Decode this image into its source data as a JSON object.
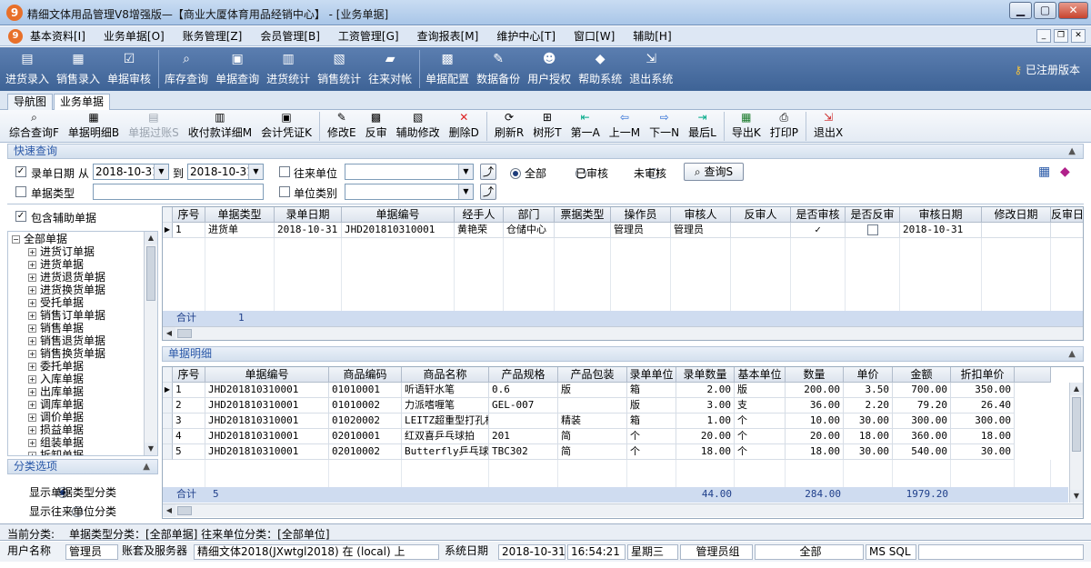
{
  "window": {
    "title": "精细文体用品管理V8增强版—【商业大厦体育用品经销中心】 - [业务单据]"
  },
  "menu": [
    "基本资料[I]",
    "业务单据[O]",
    "账务管理[Z]",
    "会员管理[B]",
    "工资管理[G]",
    "查询报表[M]",
    "维护中心[T]",
    "窗口[W]",
    "辅助[H]"
  ],
  "main_toolbar": [
    "进货录入",
    "销售录入",
    "单据审核",
    "库存查询",
    "单据查询",
    "进货统计",
    "销售统计",
    "往来对帐",
    "单据配置",
    "数据备份",
    "用户授权",
    "帮助系统",
    "退出系统"
  ],
  "registered": "已注册版本",
  "tabs": [
    "导航图",
    "业务单据"
  ],
  "sub_toolbar": [
    "综合查询F",
    "单据明细B",
    "单据过账S",
    "收付款详细M",
    "会计凭证K",
    "修改E",
    "反审",
    "辅助修改",
    "删除D",
    "刷新R",
    "树形T",
    "第一A",
    "上一M",
    "下一N",
    "最后L",
    "导出K",
    "打印P",
    "退出X"
  ],
  "quick": {
    "title": "快速查询",
    "date_label": "录单日期",
    "from": "从",
    "date_from": "2018-10-31",
    "to": "到",
    "date_to": "2018-10-31",
    "partner_label": "往来单位",
    "doc_type_label": "单据类型",
    "unit_cat_label": "单位类别",
    "all": "全部",
    "audited": "已审核",
    "unaudited": "未审核",
    "query_btn": "查询S",
    "include_aux": "包含辅助单据"
  },
  "tree": {
    "root": "全部单据",
    "items": [
      "进货订单据",
      "进货单据",
      "进货退货单据",
      "进货换货单据",
      "受托单据",
      "销售订单单据",
      "销售单据",
      "销售退货单据",
      "销售换货单据",
      "委托单据",
      "入库单据",
      "出库单据",
      "调库单据",
      "调价单据",
      "损益单据",
      "组装单据",
      "拆卸单据"
    ]
  },
  "class_opts": {
    "title": "分类选项",
    "opt1": "显示单据类型分类",
    "opt2": "显示往来单位分类"
  },
  "top_grid": {
    "headers": [
      "序号",
      "单据类型",
      "录单日期",
      "单据编号",
      "经手人",
      "部门",
      "票据类型",
      "操作员",
      "审核人",
      "反审人",
      "是否审核",
      "是否反审",
      "审核日期",
      "修改日期",
      "反审日期"
    ],
    "row": [
      "1",
      "进货单",
      "2018-10-31",
      "JHD201810310001",
      "黄艳荣",
      "仓储中心",
      "",
      "管理员",
      "管理员",
      "",
      "✓",
      "",
      "2018-10-31",
      "",
      ""
    ],
    "sum_label": "合计",
    "sum_count": "1"
  },
  "detail": {
    "title": "单据明细",
    "headers": [
      "序号",
      "单据编号",
      "商品编码",
      "商品名称",
      "产品规格",
      "产品包装",
      "录单单位",
      "录单数量",
      "基本单位",
      "数量",
      "单价",
      "金额",
      "折扣单价"
    ],
    "rows": [
      [
        "1",
        "JHD201810310001",
        "01010001",
        "听语轩水笔",
        "0.6",
        "版",
        "箱",
        "2.00",
        "版",
        "200.00",
        "3.50",
        "700.00",
        "350.00"
      ],
      [
        "2",
        "JHD201810310001",
        "01010002",
        "力派嗜喱笔",
        "GEL-007",
        "",
        "版",
        "3.00",
        "支",
        "36.00",
        "2.20",
        "79.20",
        "26.40"
      ],
      [
        "3",
        "JHD201810310001",
        "01020002",
        "LEITZ超重型打孔机",
        "",
        "精装",
        "箱",
        "1.00",
        "个",
        "10.00",
        "30.00",
        "300.00",
        "300.00"
      ],
      [
        "4",
        "JHD201810310001",
        "02010001",
        "红双喜乒乓球拍",
        "201",
        "简",
        "个",
        "20.00",
        "个",
        "20.00",
        "18.00",
        "360.00",
        "18.00"
      ],
      [
        "5",
        "JHD201810310001",
        "02010002",
        "Butterfly乒乓球拍",
        "TBC302",
        "简",
        "个",
        "18.00",
        "个",
        "18.00",
        "30.00",
        "540.00",
        "30.00"
      ]
    ],
    "sum_label": "合计",
    "sum_count": "5",
    "sum_qty": "44.00",
    "sum_num": "284.00",
    "sum_amount": "1979.20"
  },
  "status_a": {
    "label": "当前分类:",
    "text": "单据类型分类：[全部单据] 往来单位分类：[全部单位]"
  },
  "status_b": [
    "用户名称",
    "管理员",
    "账套及服务器",
    "精细文体2018(JXwtgl2018) 在 (local) 上",
    "系统日期",
    "2018-10-31",
    "16:54:21",
    "星期三",
    "管理员组",
    "全部",
    "MS SQL"
  ]
}
